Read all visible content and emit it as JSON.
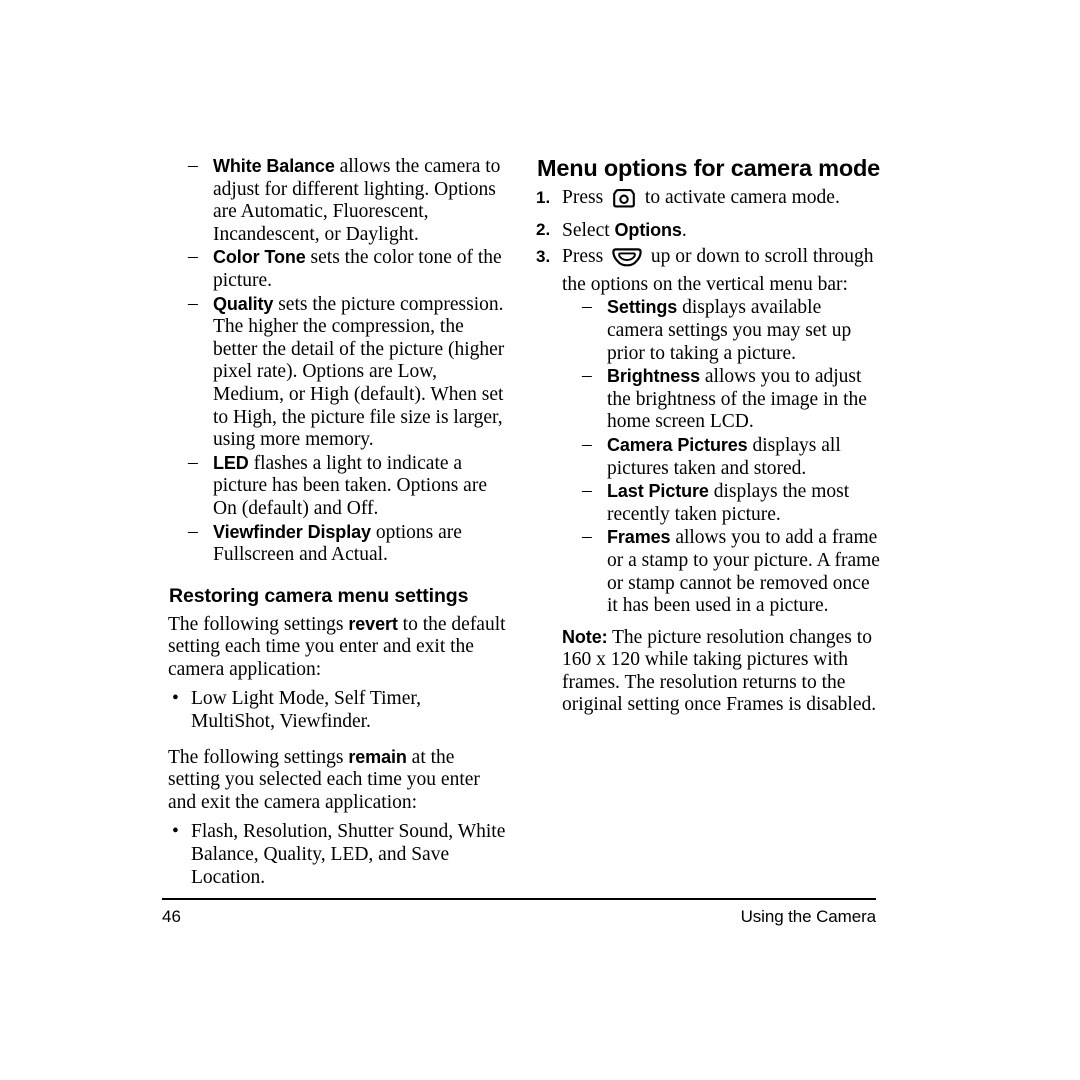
{
  "page": {
    "number": "46",
    "running_head": "Using the Camera"
  },
  "left_column": {
    "camera_settings_items": [
      {
        "marker": "–",
        "term": "White Balance",
        "text": " allows the camera to adjust for different lighting. Options are Automatic, Fluorescent, Incandescent, or Daylight."
      },
      {
        "marker": "–",
        "term": "Color Tone",
        "text": " sets the color tone of the picture."
      },
      {
        "marker": "–",
        "term": "Quality",
        "text": " sets the picture compression. The higher the compression, the better the detail of the picture (higher pixel rate). Options are Low, Medium, or High (default). When set to High, the picture file size is larger, using more memory."
      },
      {
        "marker": "–",
        "term": "LED",
        "text": " flashes a light to indicate a picture has been taken. Options are On (default) and Off."
      },
      {
        "marker": "–",
        "term": "Viewfinder Display",
        "text": " options are Fullscreen and Actual."
      }
    ],
    "restoring_heading": "Restoring camera menu settings",
    "revert_paragraph": {
      "before": "The following settings ",
      "term": "revert",
      "after": " to the default setting each time you enter and exit the camera application:"
    },
    "revert_bullets": [
      {
        "marker": "•",
        "text": "Low Light Mode, Self Timer, MultiShot, Viewfinder."
      }
    ],
    "remain_paragraph": {
      "before": "The following settings ",
      "term": "remain",
      "after": " at the setting you selected each time you enter and exit the camera application:"
    },
    "remain_bullets": [
      {
        "marker": "•",
        "text": "Flash, Resolution, Shutter Sound, White Balance, Quality, LED, and Save Location."
      }
    ]
  },
  "right_column": {
    "heading": "Menu options for camera mode",
    "steps": [
      {
        "marker": "1.",
        "text_before": "Press ",
        "icon": "camera-icon",
        "text_after": " to activate camera mode."
      },
      {
        "marker": "2.",
        "text_before": "Select ",
        "term": "Options",
        "text_after": "."
      },
      {
        "marker": "3.",
        "text_before": "Press ",
        "icon": "navigation-key-icon",
        "text_after": " up or down to scroll through the options on the vertical menu bar:"
      }
    ],
    "menu_items": [
      {
        "marker": "–",
        "term": "Settings",
        "text": " displays available camera settings you may set up prior to taking a picture."
      },
      {
        "marker": "–",
        "term": "Brightness",
        "text": " allows you to adjust the brightness of the image in the home screen LCD."
      },
      {
        "marker": "–",
        "term": "Camera Pictures",
        "text": " displays all pictures taken and stored."
      },
      {
        "marker": "–",
        "term": "Last Picture",
        "text": " displays the most recently taken picture."
      },
      {
        "marker": "–",
        "term": "Frames",
        "text": " allows you to add a frame or a stamp to your picture. A frame or stamp cannot be removed once it has been used in a picture."
      }
    ],
    "note": {
      "label": "Note:",
      "text": "  The picture resolution changes to 160 x 120 while taking pictures with frames. The resolution returns to the original setting once Frames is disabled."
    }
  },
  "colors": {
    "text": "#000000",
    "background": "#ffffff",
    "rule": "#000000"
  }
}
